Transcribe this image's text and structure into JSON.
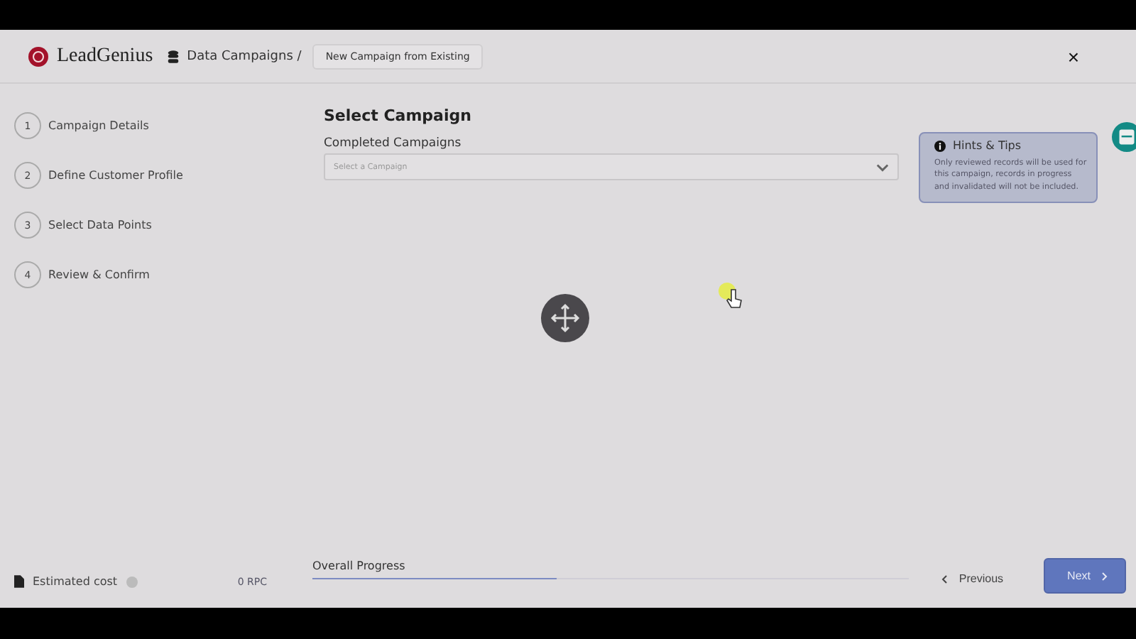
{
  "header": {
    "logo": "LeadGenius",
    "breadcrumb": "Data Campaigns /",
    "page_title": "New Campaign from Existing",
    "close": "×"
  },
  "steps": [
    {
      "number": "1",
      "label": "Campaign Details"
    },
    {
      "number": "2",
      "label": "Define Customer Profile"
    },
    {
      "number": "3",
      "label": "Select Data Points"
    },
    {
      "number": "4",
      "label": "Review & Confirm"
    }
  ],
  "main": {
    "title": "Select Campaign",
    "field_label": "Completed Campaigns",
    "placeholder": "Select a Campaign"
  },
  "hints": {
    "title": "Hints & Tips",
    "text": "Only reviewed records will be used for this campaign, records in progress and invalidated will not be included."
  },
  "footer": {
    "cost_label": "Estimated cost",
    "cost_value": "0 RPC",
    "progress_label": "Overall Progress",
    "level": 0.41,
    "previous": "Previous",
    "next": "Next"
  }
}
